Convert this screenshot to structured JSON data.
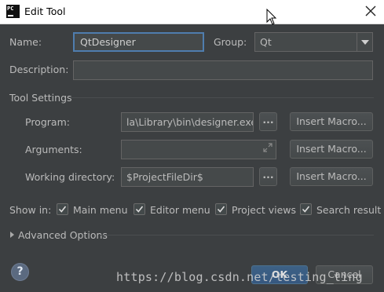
{
  "window": {
    "title": "Edit Tool",
    "app_icon_text": "PC"
  },
  "form": {
    "name_label": "Name:",
    "name_value": "QtDesigner",
    "group_label": "Group:",
    "group_value": "Qt",
    "description_label": "Description:",
    "description_value": ""
  },
  "tool_settings": {
    "title": "Tool Settings",
    "program_label": "Program:",
    "program_value": "la\\Library\\bin\\designer.exe",
    "arguments_label": "Arguments:",
    "arguments_value": "",
    "working_dir_label": "Working directory:",
    "working_dir_value": "$ProjectFileDir$",
    "browse_label": "...",
    "insert_macro_label": "Insert Macro..."
  },
  "show_in": {
    "label": "Show in:",
    "options": [
      {
        "label": "Main menu",
        "checked": true
      },
      {
        "label": "Editor menu",
        "checked": true
      },
      {
        "label": "Project views",
        "checked": true
      },
      {
        "label": "Search result",
        "checked": true
      }
    ]
  },
  "advanced": {
    "label": "Advanced Options"
  },
  "footer": {
    "help_label": "?",
    "ok_label": "OK",
    "cancel_label": "Cancel"
  },
  "watermark": {
    "text": "https://blog.csdn.net/testing_ting"
  },
  "colors": {
    "background": "#3c3f41",
    "field": "#45494a",
    "focus_border": "#4f7dae",
    "primary_button": "#365880"
  },
  "icons": [
    "pycharm-logo-icon",
    "close-icon",
    "mouse-pointer-icon",
    "chevron-down-icon",
    "expand-icon",
    "checkbox-check-icon",
    "triangle-right-icon",
    "help-icon"
  ]
}
